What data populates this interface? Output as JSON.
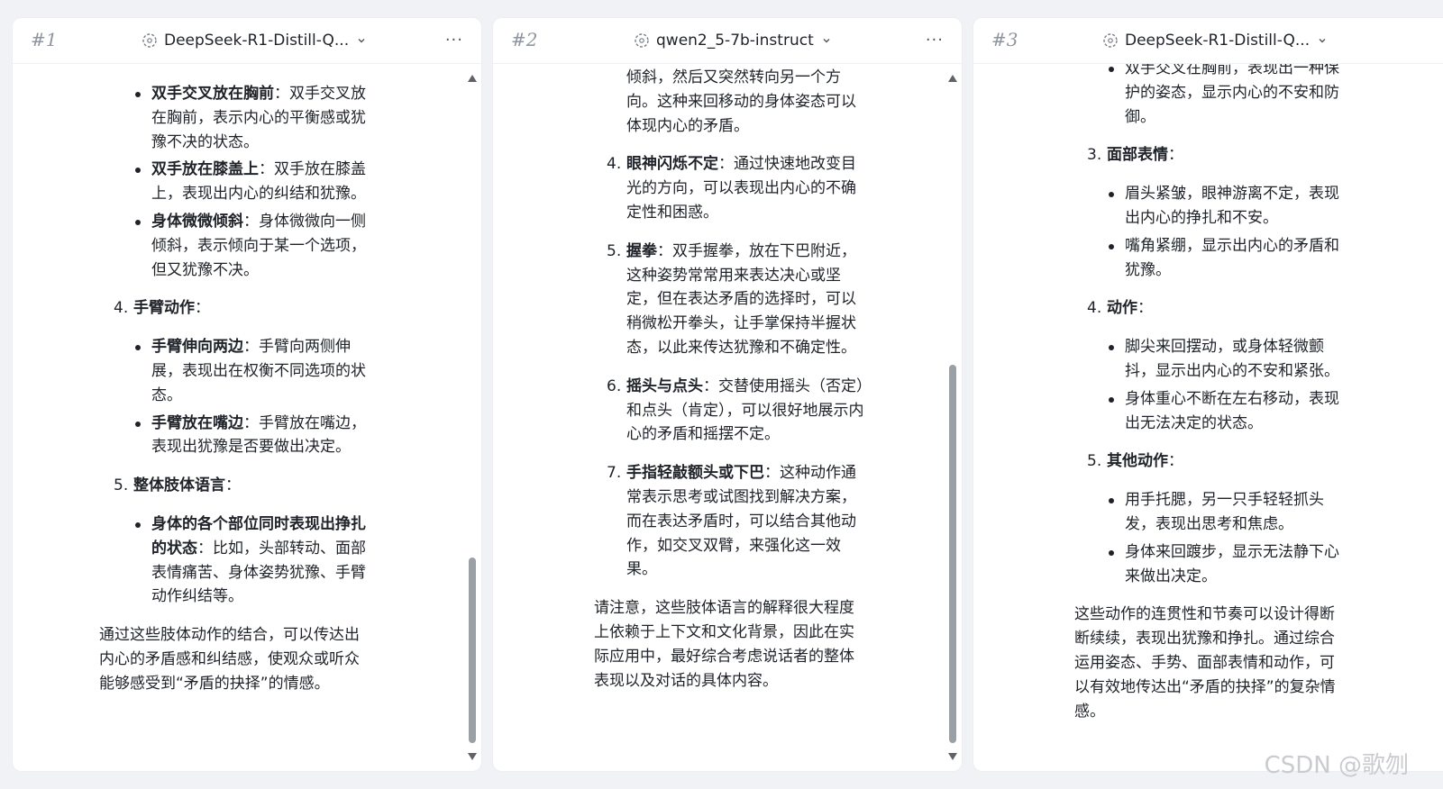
{
  "panels": [
    {
      "num": "#1",
      "model": "DeepSeek-R1-Distill-Q...",
      "items_a": [
        {
          "bold": "双手交叉放在胸前",
          "text": "：双手交叉放在胸前，表示内心的平衡感或犹豫不决的状态。"
        },
        {
          "bold": "双手放在膝盖上",
          "text": "：双手放在膝盖上，表现出内心的纠结和犹豫。"
        },
        {
          "bold": "身体微微倾斜",
          "text": "：身体微微向一侧倾斜，表示倾向于某一个选项，但又犹豫不决。"
        }
      ],
      "head4": {
        "n": "4.",
        "bold": "手臂动作",
        "text": "："
      },
      "items_b": [
        {
          "bold": "手臂伸向两边",
          "text": "：手臂向两侧伸展，表现出在权衡不同选项的状态。"
        },
        {
          "bold": "手臂放在嘴边",
          "text": "：手臂放在嘴边，表现出犹豫是否要做出决定。"
        }
      ],
      "head5": {
        "n": "5.",
        "bold": "整体肢体语言",
        "text": "："
      },
      "items_c": [
        {
          "bold": "身体的各个部位同时表现出挣扎的状态",
          "text": "：比如，头部转动、面部表情痛苦、身体姿势犹豫、手臂动作纠结等。"
        }
      ],
      "summary": "通过这些肢体动作的结合，可以传达出内心的矛盾感和纠结感，使观众或听众能够感受到“矛盾的抉择”的情感。"
    },
    {
      "num": "#2",
      "model": "qwen2_5-7b-instruct",
      "lead": "倾斜，然后又突然转向另一个方向。这种来回移动的身体姿态可以体现内心的矛盾。",
      "items": [
        {
          "n": "4.",
          "bold": "眼神闪烁不定",
          "text": "：通过快速地改变目光的方向，可以表现出内心的不确定性和困惑。"
        },
        {
          "n": "5.",
          "bold": "握拳",
          "text": "：双手握拳，放在下巴附近，这种姿势常常用来表达决心或坚定，但在表达矛盾的选择时，可以稍微松开拳头，让手掌保持半握状态，以此来传达犹豫和不确定性。"
        },
        {
          "n": "6.",
          "bold": "摇头与点头",
          "text": "：交替使用摇头（否定）和点头（肯定），可以很好地展示内心的矛盾和摇摆不定。"
        },
        {
          "n": "7.",
          "bold": "手指轻敲额头或下巴",
          "text": "：这种动作通常表示思考或试图找到解决方案，而在表达矛盾时，可以结合其他动作，如交叉双臂，来强化这一效果。"
        }
      ],
      "summary": "请注意，这些肢体语言的解释很大程度上依赖于上下文和文化背景，因此在实际应用中，最好综合考虑说话者的整体表现以及对话的具体内容。"
    },
    {
      "num": "#3",
      "model": "DeepSeek-R1-Distill-Q...",
      "top_item": "双手交叉在胸前，表现出一种保护的姿态，显示内心的不安和防御。",
      "head3": {
        "n": "3.",
        "bold": "面部表情",
        "text": "："
      },
      "items_a": [
        "眉头紧皱，眼神游离不定，表现出内心的挣扎和不安。",
        "嘴角紧绷，显示出内心的矛盾和犹豫。"
      ],
      "head4": {
        "n": "4.",
        "bold": "动作",
        "text": "："
      },
      "items_b": [
        "脚尖来回摆动，或身体轻微颤抖，显示出内心的不安和紧张。",
        "身体重心不断在左右移动，表现出无法决定的状态。"
      ],
      "head5": {
        "n": "5.",
        "bold": "其他动作",
        "text": "："
      },
      "items_c": [
        "用手托腮，另一只手轻轻抓头发，表现出思考和焦虑。",
        "身体来回踱步，显示无法静下心来做出决定。"
      ],
      "summary": "这些动作的连贯性和节奏可以设计得断断续续，表现出犹豫和挣扎。通过综合运用姿态、手势、面部表情和动作，可以有效地传达出“矛盾的抉择”的复杂情感。"
    }
  ],
  "watermark": "CSDN @歌刎"
}
